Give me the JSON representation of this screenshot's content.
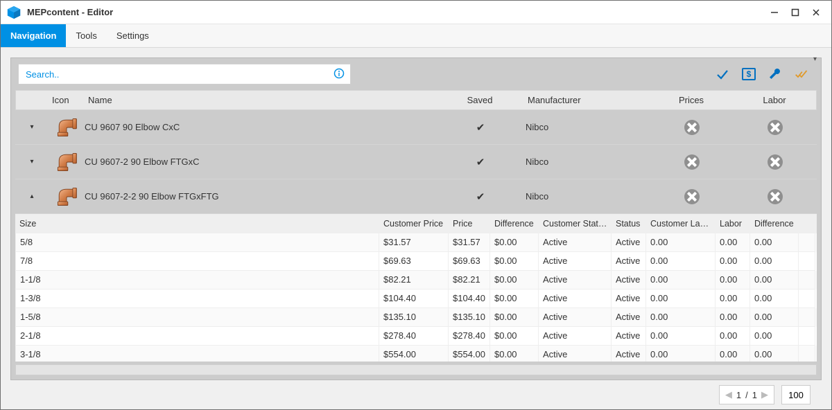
{
  "window": {
    "title": "MEPcontent - Editor"
  },
  "menu": {
    "navigation": "Navigation",
    "tools": "Tools",
    "settings": "Settings"
  },
  "search": {
    "placeholder": "Search.."
  },
  "summary_headers": {
    "icon": "Icon",
    "name": "Name",
    "saved": "Saved",
    "manufacturer": "Manufacturer",
    "prices": "Prices",
    "labor": "Labor"
  },
  "summary_rows": [
    {
      "expanded": false,
      "name": "CU 9607 90 Elbow CxC",
      "saved": "✔",
      "manufacturer": "Nibco"
    },
    {
      "expanded": false,
      "name": "CU 9607-2 90 Elbow FTGxC",
      "saved": "✔",
      "manufacturer": "Nibco"
    },
    {
      "expanded": true,
      "name": "CU 9607-2-2 90 Elbow FTGxFTG",
      "saved": "✔",
      "manufacturer": "Nibco"
    }
  ],
  "detail_headers": {
    "size": "Size",
    "customer_price": "Customer Price",
    "price": "Price",
    "difference": "Difference",
    "customer_status": "Customer Status",
    "status": "Status",
    "customer_labor": "Customer Labor",
    "labor": "Labor",
    "difference2": "Difference"
  },
  "detail_rows": [
    {
      "size": "5/8",
      "cprice": "$31.57",
      "price": "$31.57",
      "diff": "$0.00",
      "cstatus": "Active",
      "status": "Active",
      "clabor": "0.00",
      "labor": "0.00",
      "ldiff": "0.00"
    },
    {
      "size": "7/8",
      "cprice": "$69.63",
      "price": "$69.63",
      "diff": "$0.00",
      "cstatus": "Active",
      "status": "Active",
      "clabor": "0.00",
      "labor": "0.00",
      "ldiff": "0.00"
    },
    {
      "size": "1-1/8",
      "cprice": "$82.21",
      "price": "$82.21",
      "diff": "$0.00",
      "cstatus": "Active",
      "status": "Active",
      "clabor": "0.00",
      "labor": "0.00",
      "ldiff": "0.00"
    },
    {
      "size": "1-3/8",
      "cprice": "$104.40",
      "price": "$104.40",
      "diff": "$0.00",
      "cstatus": "Active",
      "status": "Active",
      "clabor": "0.00",
      "labor": "0.00",
      "ldiff": "0.00"
    },
    {
      "size": "1-5/8",
      "cprice": "$135.10",
      "price": "$135.10",
      "diff": "$0.00",
      "cstatus": "Active",
      "status": "Active",
      "clabor": "0.00",
      "labor": "0.00",
      "ldiff": "0.00"
    },
    {
      "size": "2-1/8",
      "cprice": "$278.40",
      "price": "$278.40",
      "diff": "$0.00",
      "cstatus": "Active",
      "status": "Active",
      "clabor": "0.00",
      "labor": "0.00",
      "ldiff": "0.00"
    },
    {
      "size": "3-1/8",
      "cprice": "$554.00",
      "price": "$554.00",
      "diff": "$0.00",
      "cstatus": "Active",
      "status": "Active",
      "clabor": "0.00",
      "labor": "0.00",
      "ldiff": "0.00"
    }
  ],
  "pager": {
    "current": "1",
    "sep": "/",
    "total": "1",
    "page_size": "100"
  }
}
